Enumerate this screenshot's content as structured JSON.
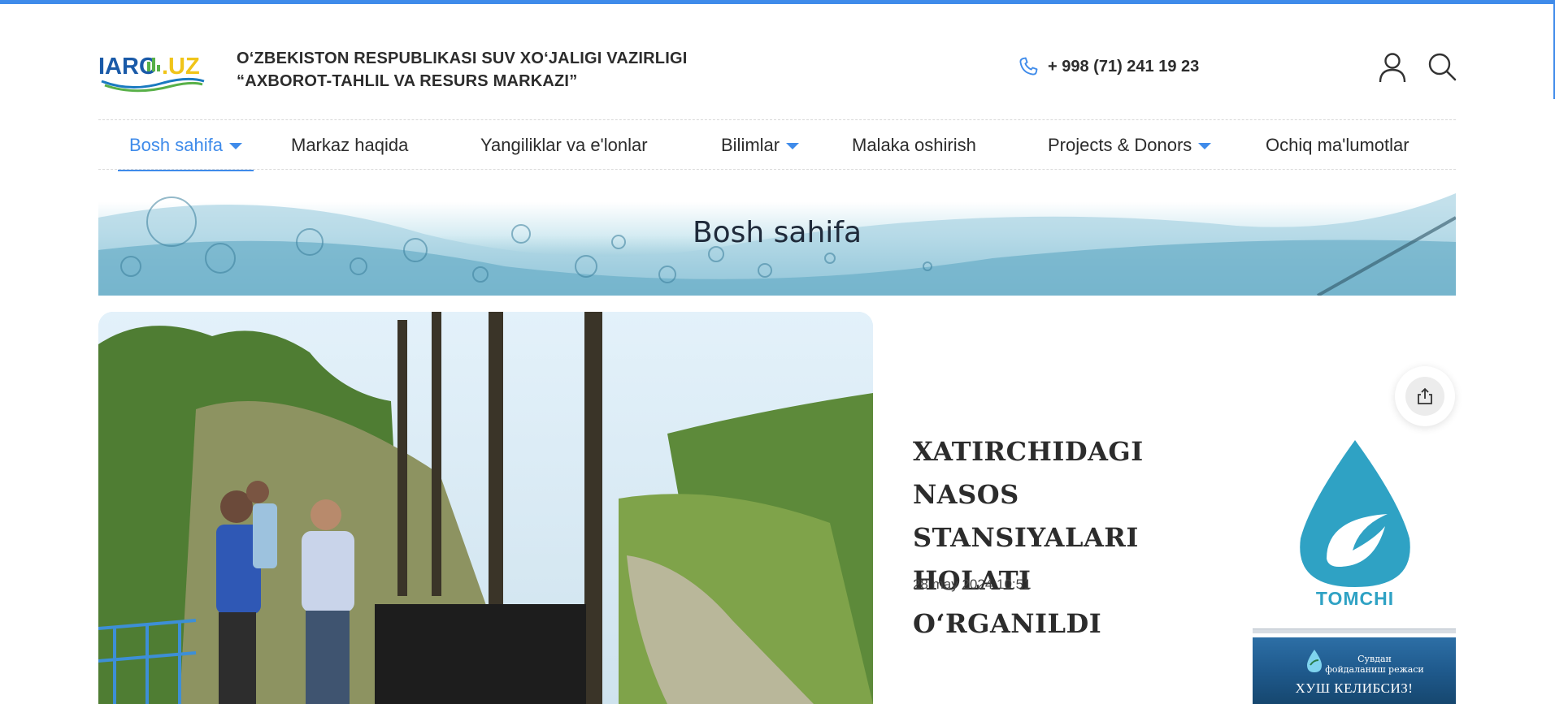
{
  "header": {
    "logo_text": "IARC.UZ",
    "org_line1": "O‘ZBEKISTON RESPUBLIKASI SUV XO‘JALIGI VAZIRLIGI",
    "org_line2": "“AXBOROT-TAHLIL VA RESURS MARKAZI”",
    "phone": "+ 998 (71) 241 19 23"
  },
  "nav": {
    "items": [
      {
        "label": "Bosh sahifa",
        "has_dropdown": true,
        "active": true
      },
      {
        "label": "Markaz haqida",
        "has_dropdown": false
      },
      {
        "label": "Yangiliklar va e'lonlar",
        "has_dropdown": false
      },
      {
        "label": "Bilimlar",
        "has_dropdown": true
      },
      {
        "label": "Malaka oshirish",
        "has_dropdown": false
      },
      {
        "label": "Projects & Donors",
        "has_dropdown": true
      },
      {
        "label": "Ochiq ma'lumotlar",
        "has_dropdown": false
      }
    ]
  },
  "banner": {
    "title": "Bosh sahifa"
  },
  "article": {
    "headline_lines": [
      "XATIRCHIDAGI NASOS",
      "STANSIYALARI HOLATI",
      "O‘RGANILDI"
    ],
    "date": "28 may 2024 10:51"
  },
  "sidebar": {
    "tomchi_label": "TOMCHI",
    "ad_subtitle_line1": "Сувдан",
    "ad_subtitle_line2": "фойдаланиш режаси",
    "ad_title": "ХУШ КЕЛИБСИЗ!"
  },
  "colors": {
    "accent": "#3f8bea",
    "tomchi": "#2fa2c4",
    "text": "#2c2c2c"
  },
  "icons": {
    "phone": "phone-icon",
    "user": "user-icon",
    "search": "search-icon",
    "share": "share-icon"
  }
}
